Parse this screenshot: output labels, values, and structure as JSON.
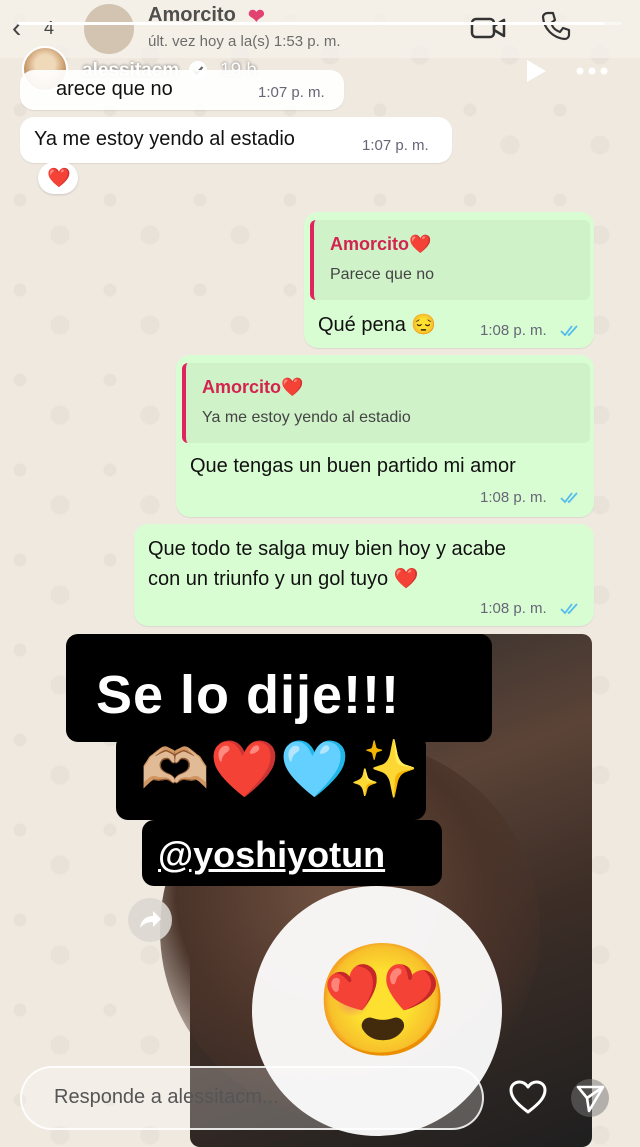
{
  "whatsapp": {
    "back_count": "4",
    "contact_name": "Amorcito",
    "last_seen": "últ. vez hoy a la(s) 1:53 p. m."
  },
  "story": {
    "username": "alessitacm",
    "time_ago": "19 h",
    "progress_fraction": 0.97,
    "reply_placeholder": "Responde a alessitacm..."
  },
  "messages": [
    {
      "direction": "in",
      "text": "arece que no",
      "time": "1:07 p. m."
    },
    {
      "direction": "in",
      "text": "Ya me estoy yendo al estadio",
      "time": "1:07 p. m.",
      "reaction": "❤️"
    },
    {
      "direction": "out",
      "quote_name": "Amorcito❤️",
      "quote_text": "Parece que no",
      "text": "Qué pena 😔",
      "time": "1:08 p. m."
    },
    {
      "direction": "out",
      "quote_name": "Amorcito❤️",
      "quote_text": "Ya me estoy yendo al estadio",
      "text": "Que tengas un buen partido mi amor",
      "time": "1:08 p. m."
    },
    {
      "direction": "out",
      "text_line1": "Que todo te salga muy bien hoy y acabe",
      "text_line2": "con un triunfo y un gol tuyo ❤️",
      "time": "1:08 p. m."
    }
  ],
  "stickers": {
    "main_text": "Se lo dije!!!",
    "emoji_line": "🫶🏼❤️🩵✨",
    "mention": "@yoshiyotun"
  },
  "reaction_emoji": "😍",
  "colors": {
    "outgoing_bubble": "#d9fdd3",
    "incoming_bubble": "#ffffff",
    "quote_accent": "#e0245e",
    "read_ticks": "#53bdeb"
  }
}
